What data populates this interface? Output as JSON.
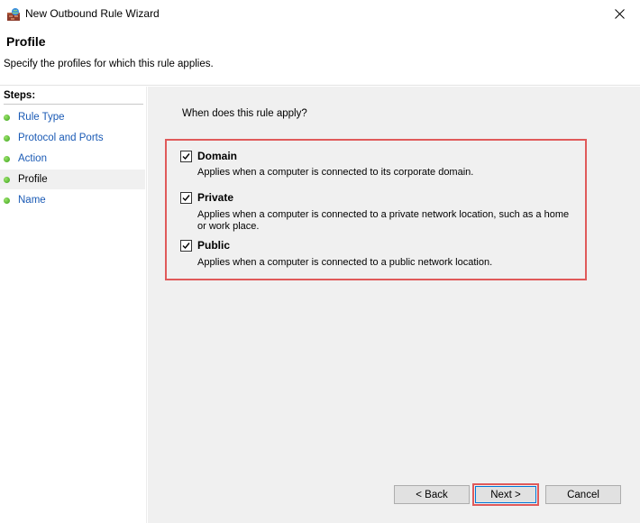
{
  "window": {
    "title": "New Outbound Rule Wizard",
    "icon": "firewall-wizard-icon"
  },
  "header": {
    "title": "Profile",
    "subtitle": "Specify the profiles for which this rule applies."
  },
  "sidebar": {
    "label": "Steps:",
    "items": [
      {
        "label": "Rule Type"
      },
      {
        "label": "Protocol and Ports"
      },
      {
        "label": "Action"
      },
      {
        "label": "Profile"
      },
      {
        "label": "Name"
      }
    ],
    "active_index": 3
  },
  "main": {
    "question": "When does this rule apply?",
    "options": [
      {
        "name": "Domain",
        "checked": true,
        "description": "Applies when a computer is connected to its corporate domain."
      },
      {
        "name": "Private",
        "checked": true,
        "description": "Applies when a computer is connected to a private network location, such as a home or work place."
      },
      {
        "name": "Public",
        "checked": true,
        "description": "Applies when a computer is connected to a public network location."
      }
    ]
  },
  "buttons": {
    "back": "< Back",
    "next": "Next >",
    "cancel": "Cancel"
  },
  "colors": {
    "highlight": "#e05a5a",
    "link": "#1a5ab5",
    "panel": "#f0f0f0"
  }
}
